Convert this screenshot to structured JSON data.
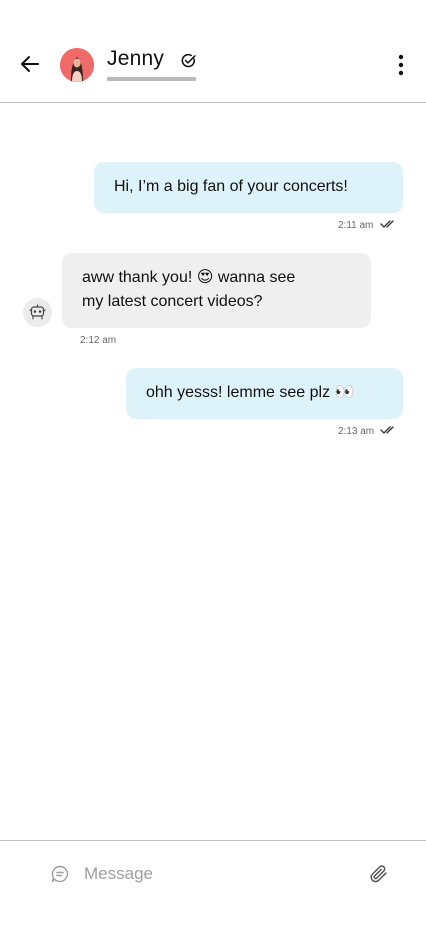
{
  "header": {
    "name": "Jenny",
    "back_icon": "arrow-left-icon",
    "verified_icon": "check-circle-icon",
    "menu_icon": "more-vertical-icon",
    "avatar_bg": "#f06a6a"
  },
  "messages": [
    {
      "direction": "outgoing",
      "text": "Hi, I’m a big fan of your concerts!",
      "time": "2:11 am",
      "status": "read"
    },
    {
      "direction": "incoming",
      "lines": [
        "aww thank you! 😍 wanna see",
        "my latest concert videos?"
      ],
      "time": "2:12 am"
    },
    {
      "direction": "outgoing",
      "text": "ohh yesss! lemme see plz 👀",
      "time": "2:13 am",
      "status": "read"
    }
  ],
  "composer": {
    "placeholder": "Message",
    "value": "",
    "message_icon": "chat-bubble-icon",
    "attach_icon": "paperclip-icon"
  },
  "colors": {
    "outgoing_bubble": "#def2fa",
    "incoming_bubble": "#efeff0",
    "divider": "#bdbdbd"
  }
}
